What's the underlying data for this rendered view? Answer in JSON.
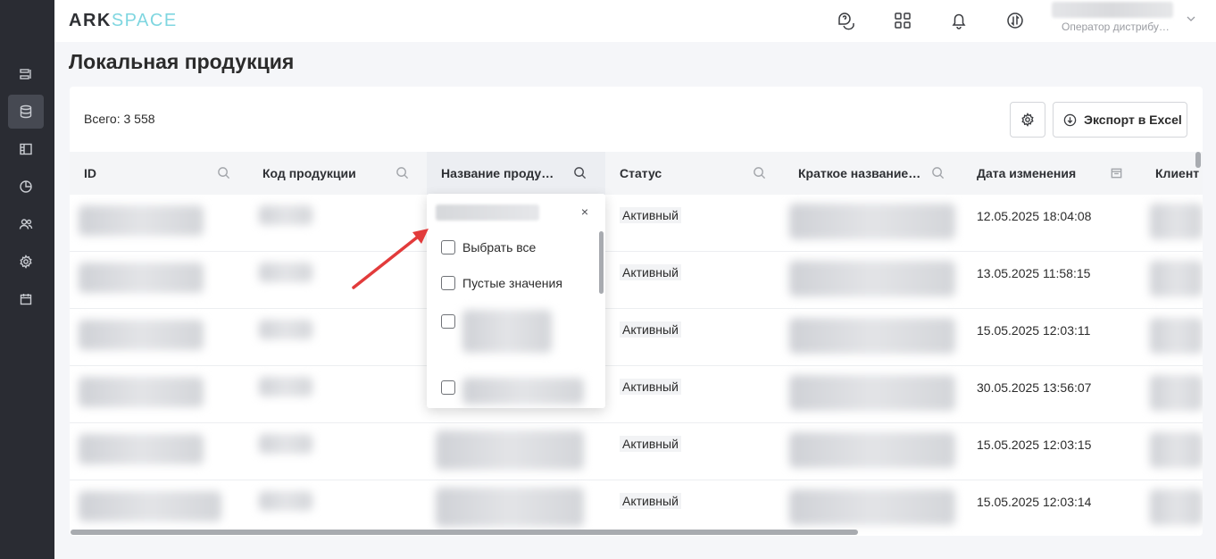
{
  "app": {
    "logo_ark": "ARK",
    "logo_space": "SPACE"
  },
  "header": {
    "user_role": "Оператор дистрибу…",
    "icons": [
      "help-chat-icon",
      "apps-grid-icon",
      "bell-icon",
      "switch-icon",
      "chevron-down-icon"
    ]
  },
  "sidebar": {
    "items": [
      {
        "icon": "list-icon",
        "active": false
      },
      {
        "icon": "database-icon",
        "active": true
      },
      {
        "icon": "layout-icon",
        "active": false
      },
      {
        "icon": "pie-chart-icon",
        "active": false
      },
      {
        "icon": "users-icon",
        "active": false
      },
      {
        "icon": "settings-icon",
        "active": false
      },
      {
        "icon": "calendar-icon",
        "active": false
      }
    ]
  },
  "page": {
    "title": "Локальная продукция"
  },
  "toolbar": {
    "total": "Всего: 3 558",
    "export_label": "Экспорт в Excel"
  },
  "table": {
    "columns": [
      "ID",
      "Код продукции",
      "Название проду…",
      "Статус",
      "Краткое название…",
      "Дата изменения",
      "Клиент"
    ],
    "rows": [
      {
        "status": "Активный",
        "date": "12.05.2025 18:04:08"
      },
      {
        "status": "Активный",
        "date": "13.05.2025 11:58:15"
      },
      {
        "status": "Активный",
        "date": "15.05.2025 12:03:11"
      },
      {
        "status": "Активный",
        "date": "30.05.2025 13:56:07"
      },
      {
        "status": "Активный",
        "date": "15.05.2025 12:03:15"
      },
      {
        "status": "Активный",
        "date": "15.05.2025 12:03:14"
      }
    ]
  },
  "filter_dropdown": {
    "close": "×",
    "select_all": "Выбрать все",
    "empty_values": "Пустые значения"
  }
}
